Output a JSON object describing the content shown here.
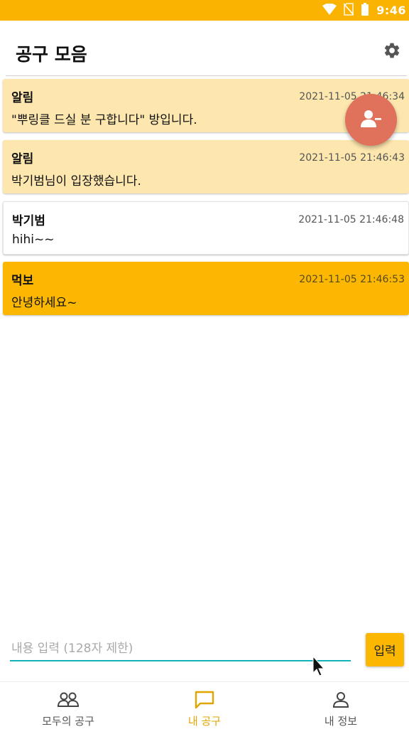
{
  "status_bar": {
    "time": "9:46",
    "icons": [
      "wifi-icon",
      "no-sim-icon",
      "battery-icon"
    ],
    "color": "#F9B300"
  },
  "app_bar": {
    "title": "공구 모음",
    "action_icon": "gear-icon"
  },
  "messages": [
    {
      "type": "system",
      "sender": "알림",
      "time": "2021-11-05 21:46:34",
      "text": "\"뿌링클 드실 분 구합니다\" 방입니다."
    },
    {
      "type": "system",
      "sender": "알림",
      "time": "2021-11-05 21:46:43",
      "text": "박기범님이 입장했습니다."
    },
    {
      "type": "other",
      "sender": "박기범",
      "time": "2021-11-05 21:46:48",
      "text": "hihi~~"
    },
    {
      "type": "mine",
      "sender": "먹보",
      "time": "2021-11-05 21:46:53",
      "text": "안녕하세요~"
    }
  ],
  "fab": {
    "icon": "remove-person-icon",
    "color": "#E0715A"
  },
  "composer": {
    "placeholder": "내용 입력 (128자 제한)",
    "value": "",
    "send_label": "입력"
  },
  "bottom_nav": {
    "active": "내 공구",
    "items": [
      {
        "label": "모두의 공구",
        "icon": "group-icon"
      },
      {
        "label": "내 공구",
        "icon": "chat-icon"
      },
      {
        "label": "내 정보",
        "icon": "person-icon"
      }
    ]
  },
  "colors": {
    "accent": "#FCB702",
    "system_card": "#FDE7AF",
    "input_underline": "#12B3BC",
    "nav_active": "#E0A600"
  }
}
